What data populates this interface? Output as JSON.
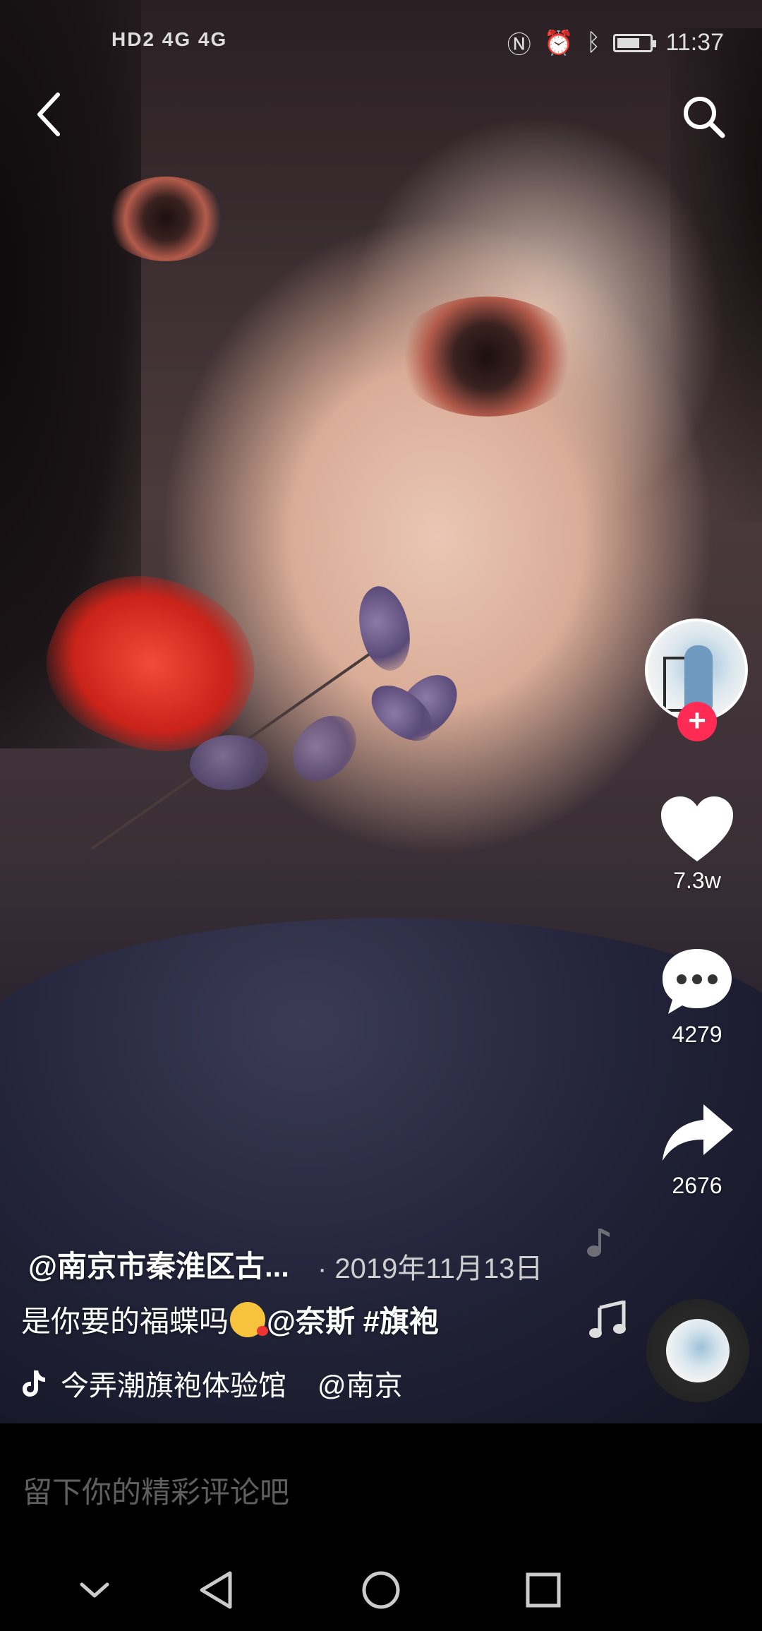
{
  "status_bar": {
    "left_indicators": "HD2  4G  4G",
    "time": "11:37",
    "battery_level": 0.7
  },
  "top_nav": {
    "back_icon": "chevron-left-icon",
    "search_icon": "search-icon"
  },
  "right_rail": {
    "likes": "7.3w",
    "comments": "4279",
    "shares": "2676",
    "follow_symbol": "+"
  },
  "post": {
    "author": "@南京市秦淮区古...",
    "date": "· 2019年11月13日",
    "caption_text": "是你要的福蝶吗",
    "mention": "@奈斯",
    "hashtag": "#旗袍",
    "music_title": "今弄潮旗袍体验馆",
    "music_location": "@南京"
  },
  "comment_bar": {
    "placeholder": "留下你的精彩评论吧"
  },
  "colors": {
    "accent": "#fe2c55",
    "background": "#000000"
  }
}
